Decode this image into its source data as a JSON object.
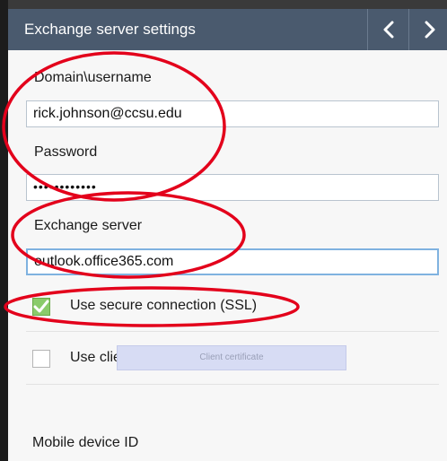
{
  "header": {
    "title": "Exchange server settings",
    "prev_icon": "chevron-left-icon",
    "next_icon": "chevron-right-icon"
  },
  "form": {
    "domain_label": "Domain\\username",
    "domain_value": "rick.johnson@ccsu.edu",
    "password_label": "Password",
    "password_value": "••••••••••••",
    "server_label": "Exchange server",
    "server_value": "outlook.office365.com",
    "ssl_label": "Use secure connection (SSL)",
    "ssl_checked": true,
    "client_cert_label": "Use client certificate",
    "client_cert_checked": false,
    "client_cert_button": "Client certificate",
    "device_id_label": "Mobile device ID"
  },
  "colors": {
    "header_bg": "#4a5a6e",
    "checkbox_checked": "#8acb6a",
    "annotation_red": "#e3001b"
  }
}
